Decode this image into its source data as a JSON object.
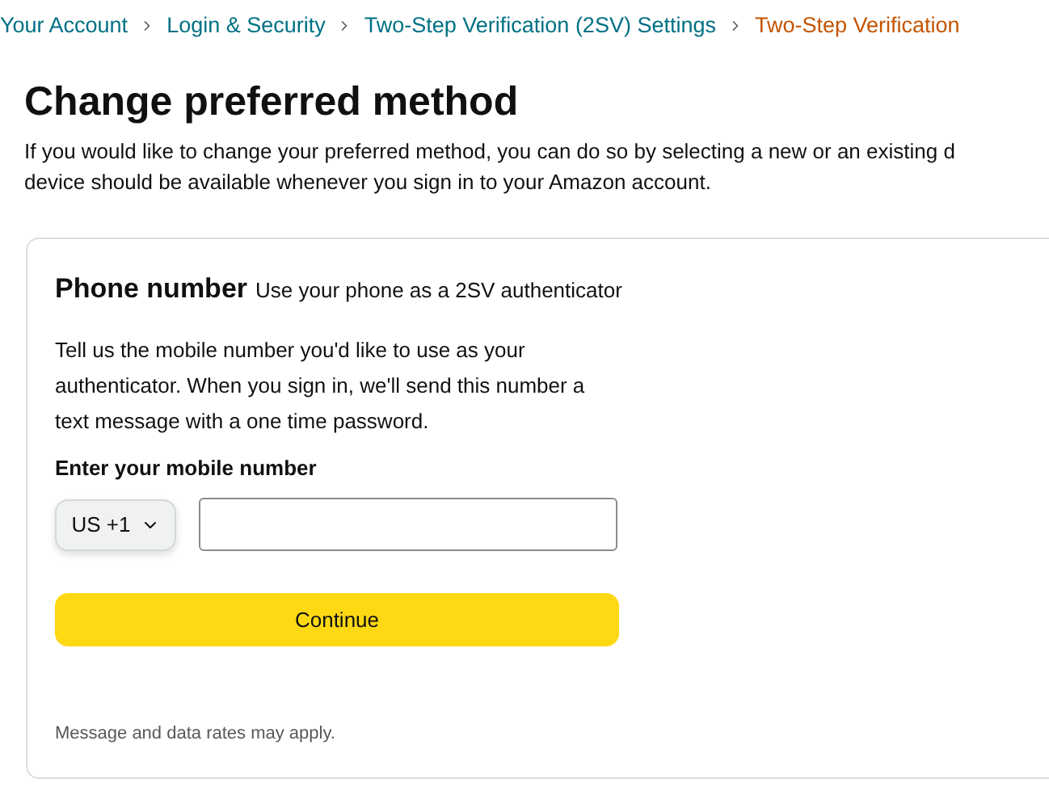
{
  "breadcrumb": [
    {
      "label": "Your Account",
      "selected": false
    },
    {
      "label": "Login & Security",
      "selected": false
    },
    {
      "label": "Two-Step Verification (2SV) Settings",
      "selected": false
    },
    {
      "label": "Two-Step Verification",
      "selected": true
    }
  ],
  "heading": "Change preferred method",
  "intro": "If you would like to change your preferred method, you can do so by selecting a new or an existing d",
  "intro_line_2": "device should be available whenever you sign in to your Amazon account.",
  "card": {
    "title": "Phone number",
    "subtitle": "Use your phone as a 2SV authenticator",
    "description": "Tell us the mobile number you'd like to use as your authenticator. When you sign in, we'll send this number a text message with a one time password.",
    "field_label": "Enter your mobile number",
    "country_code": "US +1",
    "button": "Continue",
    "footnote": "Message and data rates may apply."
  }
}
